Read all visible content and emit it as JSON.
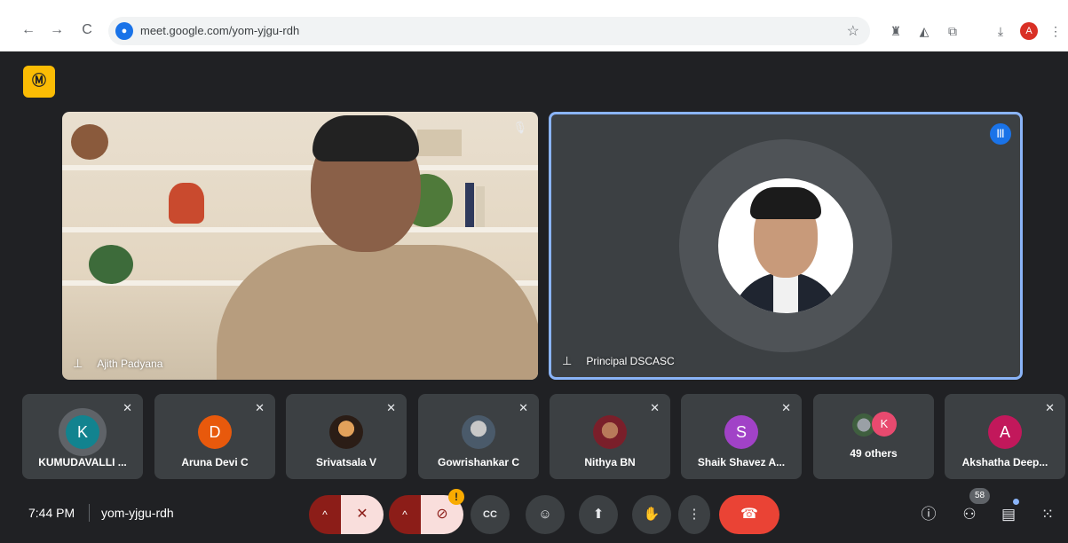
{
  "browser": {
    "url": "meet.google.com/yom-yjgu-rdh",
    "profile_initial": "A"
  },
  "meeting": {
    "time": "7:44 PM",
    "code": "yom-yjgu-rdh",
    "participant_count": "58"
  },
  "main_tiles": [
    {
      "name": "Ajith Padyana"
    },
    {
      "name": "Principal DSCASC"
    }
  ],
  "participants": [
    {
      "name": "KUMUDAVALLI ...",
      "initial": "K",
      "color": "#12838f"
    },
    {
      "name": "Aruna Devi C",
      "initial": "D",
      "color": "#e8590c"
    },
    {
      "name": "Srivatsala V"
    },
    {
      "name": "Gowrishankar C"
    },
    {
      "name": "Nithya BN"
    },
    {
      "name": "Shaik Shavez A...",
      "initial": "S",
      "color": "#a142c7"
    },
    {
      "others_label": "49 others",
      "initial": "K",
      "color": "#e84a6f"
    },
    {
      "name": "Akshatha Deep...",
      "initial": "A",
      "color": "#c2185b"
    }
  ],
  "icons": {
    "back": "←",
    "forward": "→",
    "reload": "C",
    "star": "☆",
    "mic_off": "🎙",
    "pin": "📌",
    "camera_off": "⊘",
    "captions": "CC",
    "emoji": "☺",
    "present": "⬆",
    "hand": "✋",
    "more": "⋮",
    "hangup": "☎",
    "info": "ⓘ",
    "people": "👥",
    "chat": "💬",
    "activities": "⋮⋮",
    "warning": "!",
    "speaking": "|||",
    "door": "Ⓜ",
    "chevron_up": "^"
  }
}
